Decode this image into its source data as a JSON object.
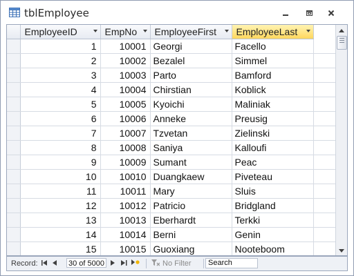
{
  "window": {
    "title": "tblEmployee",
    "icon": "table-icon",
    "controls": [
      "minimize-icon",
      "restore-icon",
      "close-icon"
    ]
  },
  "columns": [
    {
      "label": "EmployeeID",
      "selected": false
    },
    {
      "label": "EmpNo",
      "selected": false
    },
    {
      "label": "EmployeeFirst",
      "selected": false
    },
    {
      "label": "EmployeeLast",
      "selected": true
    }
  ],
  "rows": [
    {
      "id": "1",
      "empno": "10001",
      "first": "Georgi",
      "last": "Facello"
    },
    {
      "id": "2",
      "empno": "10002",
      "first": "Bezalel",
      "last": "Simmel"
    },
    {
      "id": "3",
      "empno": "10003",
      "first": "Parto",
      "last": "Bamford"
    },
    {
      "id": "4",
      "empno": "10004",
      "first": "Chirstian",
      "last": "Koblick"
    },
    {
      "id": "5",
      "empno": "10005",
      "first": "Kyoichi",
      "last": "Maliniak"
    },
    {
      "id": "6",
      "empno": "10006",
      "first": "Anneke",
      "last": "Preusig"
    },
    {
      "id": "7",
      "empno": "10007",
      "first": "Tzvetan",
      "last": "Zielinski"
    },
    {
      "id": "8",
      "empno": "10008",
      "first": "Saniya",
      "last": "Kalloufi"
    },
    {
      "id": "9",
      "empno": "10009",
      "first": "Sumant",
      "last": "Peac"
    },
    {
      "id": "10",
      "empno": "10010",
      "first": "Duangkaew",
      "last": "Piveteau"
    },
    {
      "id": "11",
      "empno": "10011",
      "first": "Mary",
      "last": "Sluis"
    },
    {
      "id": "12",
      "empno": "10012",
      "first": "Patricio",
      "last": "Bridgland"
    },
    {
      "id": "13",
      "empno": "10013",
      "first": "Eberhardt",
      "last": "Terkki"
    },
    {
      "id": "14",
      "empno": "10014",
      "first": "Berni",
      "last": "Genin"
    },
    {
      "id": "15",
      "empno": "10015",
      "first": "Guoxiang",
      "last": "Nooteboom"
    }
  ],
  "navigation": {
    "record_label": "Record:",
    "record_position": "30 of 5000",
    "filter_label": "No Filter",
    "search_placeholder": "Search"
  },
  "colors": {
    "selected_header": "#ffd75e",
    "border": "#9aa6bb"
  }
}
